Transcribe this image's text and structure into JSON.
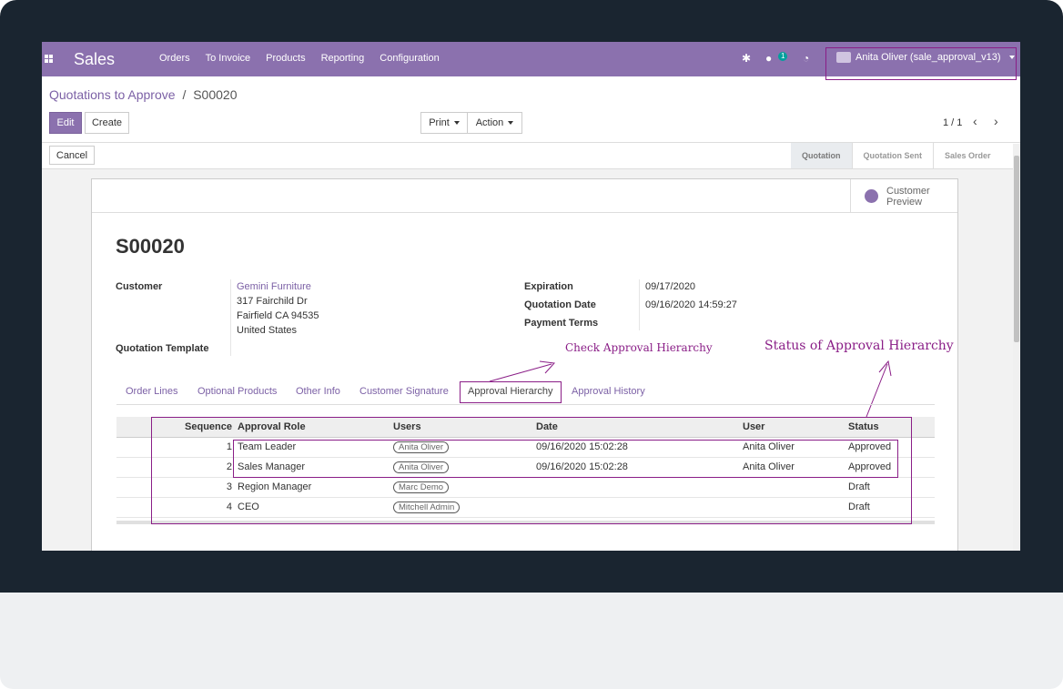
{
  "navbar": {
    "brand": "Sales",
    "menu": [
      "Orders",
      "To Invoice",
      "Products",
      "Reporting",
      "Configuration"
    ],
    "message_count": "1",
    "user": "Anita Oliver (sale_approval_v13)"
  },
  "breadcrumb": {
    "parent": "Quotations to Approve",
    "separator": "/",
    "current": "S00020"
  },
  "toolbar": {
    "edit": "Edit",
    "create": "Create",
    "print": "Print",
    "action": "Action",
    "pager": "1 / 1",
    "cancel": "Cancel"
  },
  "status_steps": [
    "Quotation",
    "Quotation Sent",
    "Sales Order"
  ],
  "preview": {
    "line1": "Customer",
    "line2": "Preview"
  },
  "form": {
    "name": "S00020",
    "customer_label": "Customer",
    "customer_name": "Gemini Furniture",
    "address1": "317 Fairchild Dr",
    "address2": "Fairfield CA 94535",
    "address3": "United States",
    "template_label": "Quotation Template",
    "expiration_label": "Expiration",
    "expiration_value": "09/17/2020",
    "quotation_date_label": "Quotation Date",
    "quotation_date_value": "09/16/2020 14:59:27",
    "payment_terms_label": "Payment Terms"
  },
  "tabs": [
    "Order Lines",
    "Optional Products",
    "Other Info",
    "Customer Signature",
    "Approval Hierarchy",
    "Approval History"
  ],
  "table": {
    "headers": [
      "Sequence",
      "Approval Role",
      "Users",
      "Date",
      "User",
      "Status"
    ],
    "rows": [
      {
        "seq": "1",
        "role": "Team Leader",
        "users": "Anita Oliver",
        "date": "09/16/2020 15:02:28",
        "user": "Anita Oliver",
        "status": "Approved"
      },
      {
        "seq": "2",
        "role": "Sales Manager",
        "users": "Anita Oliver",
        "date": "09/16/2020 15:02:28",
        "user": "Anita Oliver",
        "status": "Approved"
      },
      {
        "seq": "3",
        "role": "Region Manager",
        "users": "Marc Demo",
        "date": "",
        "user": "",
        "status": "Draft"
      },
      {
        "seq": "4",
        "role": "CEO",
        "users": "Mitchell Admin",
        "date": "",
        "user": "",
        "status": "Draft"
      }
    ]
  },
  "annotations": {
    "check": "Check Approval Hierarchy",
    "status": "Status of Approval Hierarchy"
  },
  "colors": {
    "brand": "#8b71ae",
    "annotation": "#8a1e87"
  }
}
